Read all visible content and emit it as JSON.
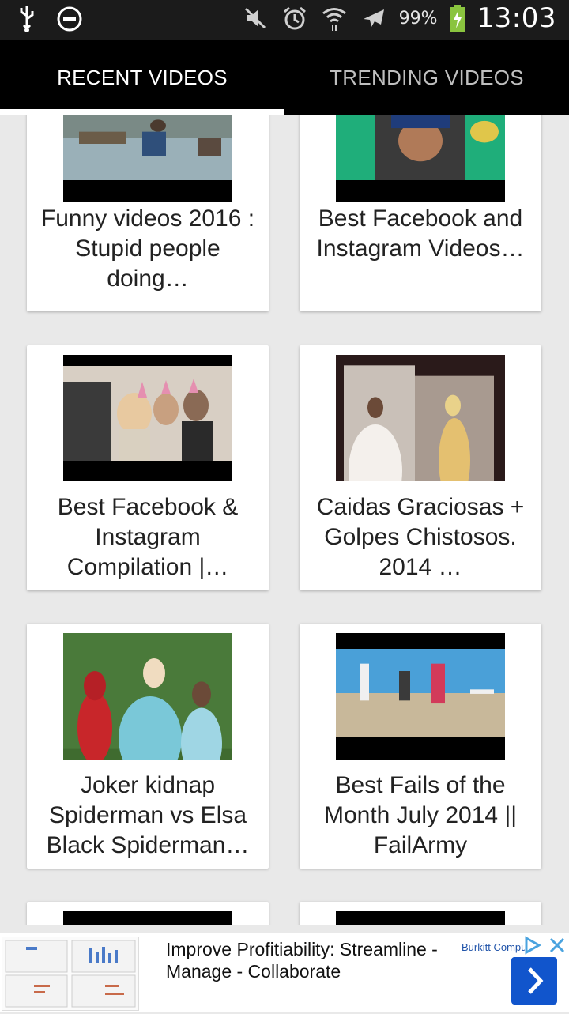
{
  "status_bar": {
    "battery_percent": "99%",
    "time": "13:03",
    "icons": [
      "usb-icon",
      "do-not-disturb-icon",
      "mute-icon",
      "alarm-icon",
      "wifi-icon",
      "airplane-mode-icon",
      "battery-charging-icon"
    ]
  },
  "tabs": [
    {
      "label": "RECENT VIDEOS",
      "active": true
    },
    {
      "label": "TRENDING VIDEOS",
      "active": false
    }
  ],
  "videos": [
    {
      "title": "Funny videos 2016 : Stupid people doing…"
    },
    {
      "title": "Best Facebook and Instagram Videos…"
    },
    {
      "title": "Best Facebook & Instagram Compilation |…"
    },
    {
      "title": "Caidas Graciosas + Golpes Chistosos. 2014 …"
    },
    {
      "title": "Joker kidnap Spiderman vs Elsa Black Spiderman…"
    },
    {
      "title": "Best Fails of the Month July 2014 || FailArmy"
    }
  ],
  "ad": {
    "headline": "Improve Profitiability: Streamline - Manage - Collaborate",
    "brand": "Burkitt Compu",
    "colors": {
      "button": "#1155cc",
      "choices": "#4aa3df"
    }
  }
}
